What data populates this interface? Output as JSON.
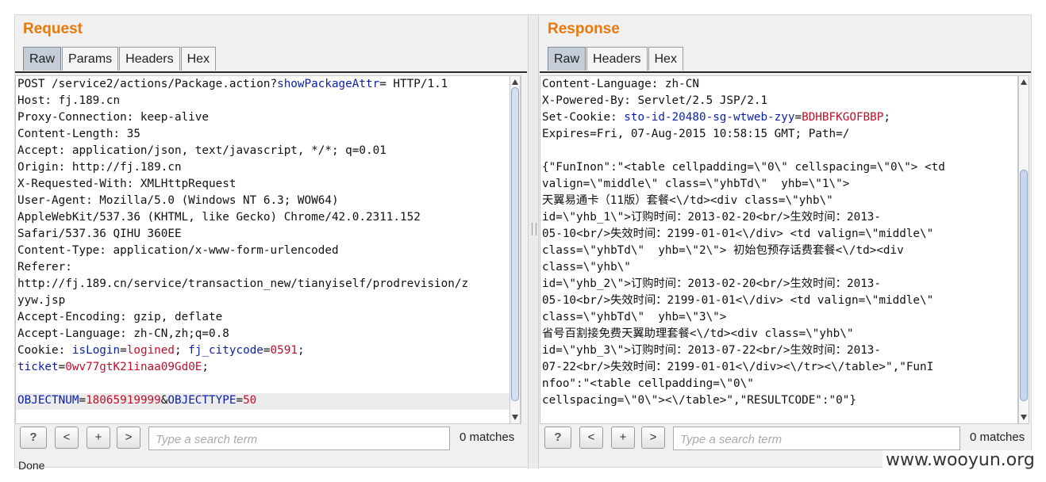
{
  "request": {
    "title": "Request",
    "tabs": [
      "Raw",
      "Params",
      "Headers",
      "Hex"
    ],
    "lines": [
      [
        {
          "t": "POST /service2/actions/Package.action?"
        },
        {
          "t": "showPackageAttr",
          "c": "k"
        },
        {
          "t": "= HTTP/1.1"
        }
      ],
      [
        {
          "t": "Host: fj.189.cn"
        }
      ],
      [
        {
          "t": "Proxy-Connection: keep-alive"
        }
      ],
      [
        {
          "t": "Content-Length: 35"
        }
      ],
      [
        {
          "t": "Accept: application/json, text/javascript, */*; q=0.01"
        }
      ],
      [
        {
          "t": "Origin: http://fj.189.cn"
        }
      ],
      [
        {
          "t": "X-Requested-With: XMLHttpRequest"
        }
      ],
      [
        {
          "t": "User-Agent: Mozilla/5.0 (Windows NT 6.3; WOW64)"
        }
      ],
      [
        {
          "t": "AppleWebKit/537.36 (KHTML, like Gecko) Chrome/42.0.2311.152"
        }
      ],
      [
        {
          "t": "Safari/537.36 QIHU 360EE"
        }
      ],
      [
        {
          "t": "Content-Type: application/x-www-form-urlencoded"
        }
      ],
      [
        {
          "t": "Referer:"
        }
      ],
      [
        {
          "t": "http://fj.189.cn/service/transaction_new/tianyiself/prodrevision/z"
        }
      ],
      [
        {
          "t": "yyw.jsp"
        }
      ],
      [
        {
          "t": "Accept-Encoding: gzip, deflate"
        }
      ],
      [
        {
          "t": "Accept-Language: zh-CN,zh;q=0.8"
        }
      ],
      [
        {
          "t": "Cookie: "
        },
        {
          "t": "isLogin",
          "c": "k"
        },
        {
          "t": "="
        },
        {
          "t": "logined",
          "c": "v"
        },
        {
          "t": "; "
        },
        {
          "t": "fj_citycode",
          "c": "k"
        },
        {
          "t": "="
        },
        {
          "t": "0591",
          "c": "v"
        },
        {
          "t": ";"
        }
      ],
      [
        {
          "t": "ticket",
          "c": "k"
        },
        {
          "t": "="
        },
        {
          "t": "0wv77gtK21inaa09Gd0E",
          "c": "v"
        },
        {
          "t": ";"
        }
      ],
      [
        {
          "t": ""
        }
      ],
      [
        {
          "t": "OBJECTNUM",
          "c": "k"
        },
        {
          "t": "="
        },
        {
          "t": "18065919999",
          "c": "v"
        },
        {
          "t": "&"
        },
        {
          "t": "OBJECTTYPE",
          "c": "k"
        },
        {
          "t": "="
        },
        {
          "t": "50",
          "c": "v"
        }
      ]
    ],
    "search": {
      "placeholder": "Type a search term",
      "matches": "0 matches"
    },
    "buttons": {
      "help": "?",
      "prev": "<",
      "plus": "+",
      "next": ">"
    },
    "status": "Done"
  },
  "response": {
    "title": "Response",
    "tabs": [
      "Raw",
      "Headers",
      "Hex"
    ],
    "lines": [
      [
        {
          "t": "Content-Language: zh-CN"
        }
      ],
      [
        {
          "t": "X-Powered-By: Servlet/2.5 JSP/2.1"
        }
      ],
      [
        {
          "t": "Set-Cookie: "
        },
        {
          "t": "sto-id-20480-sg-wtweb-zyy",
          "c": "k"
        },
        {
          "t": "="
        },
        {
          "t": "BDHBFKGOFBBP",
          "c": "v"
        },
        {
          "t": ";"
        }
      ],
      [
        {
          "t": "Expires=Fri, 07-Aug-2015 10:58:15 GMT; Path=/"
        }
      ],
      [
        {
          "t": ""
        }
      ],
      [
        {
          "t": "{\"FunInon\":\"<table cellpadding=\\\"0\\\" cellspacing=\\\"0\\\"> <td"
        }
      ],
      [
        {
          "t": "valign=\\\"middle\\\" class=\\\"yhbTd\\\"  yhb=\\\"1\\\">"
        }
      ],
      [
        {
          "t": "天翼易通卡（11版）套餐<\\/td><div class=\\\"yhb\\\""
        }
      ],
      [
        {
          "t": "id=\\\"yhb_1\\\">订购时间：2013-02-20<br/>生效时间：2013-"
        }
      ],
      [
        {
          "t": "05-10<br/>失效时间：2199-01-01<\\/div> <td valign=\\\"middle\\\""
        }
      ],
      [
        {
          "t": "class=\\\"yhbTd\\\"  yhb=\\\"2\\\"> 初始包预存话费套餐<\\/td><div"
        }
      ],
      [
        {
          "t": "class=\\\"yhb\\\""
        }
      ],
      [
        {
          "t": "id=\\\"yhb_2\\\">订购时间：2013-02-20<br/>生效时间：2013-"
        }
      ],
      [
        {
          "t": "05-10<br/>失效时间：2199-01-01<\\/div> <td valign=\\\"middle\\\""
        }
      ],
      [
        {
          "t": "class=\\\"yhbTd\\\"  yhb=\\\"3\\\">"
        }
      ],
      [
        {
          "t": "省号百割接免费天翼助理套餐<\\/td><div class=\\\"yhb\\\""
        }
      ],
      [
        {
          "t": "id=\\\"yhb_3\\\">订购时间：2013-07-22<br/>生效时间：2013-"
        }
      ],
      [
        {
          "t": "07-22<br/>失效时间：2199-01-01<\\/div><\\/tr><\\/table>\",\"FunI"
        }
      ],
      [
        {
          "t": "nfoo\":\"<table cellpadding=\\\"0\\\""
        }
      ],
      [
        {
          "t": "cellspacing=\\\"0\\\"><\\/table>\",\"RESULTCODE\":\"0\"}"
        }
      ]
    ],
    "search": {
      "placeholder": "Type a search term",
      "matches": "0 matches"
    },
    "buttons": {
      "help": "?",
      "prev": "<",
      "plus": "+",
      "next": ">"
    }
  },
  "watermark": "www.wooyun.org"
}
